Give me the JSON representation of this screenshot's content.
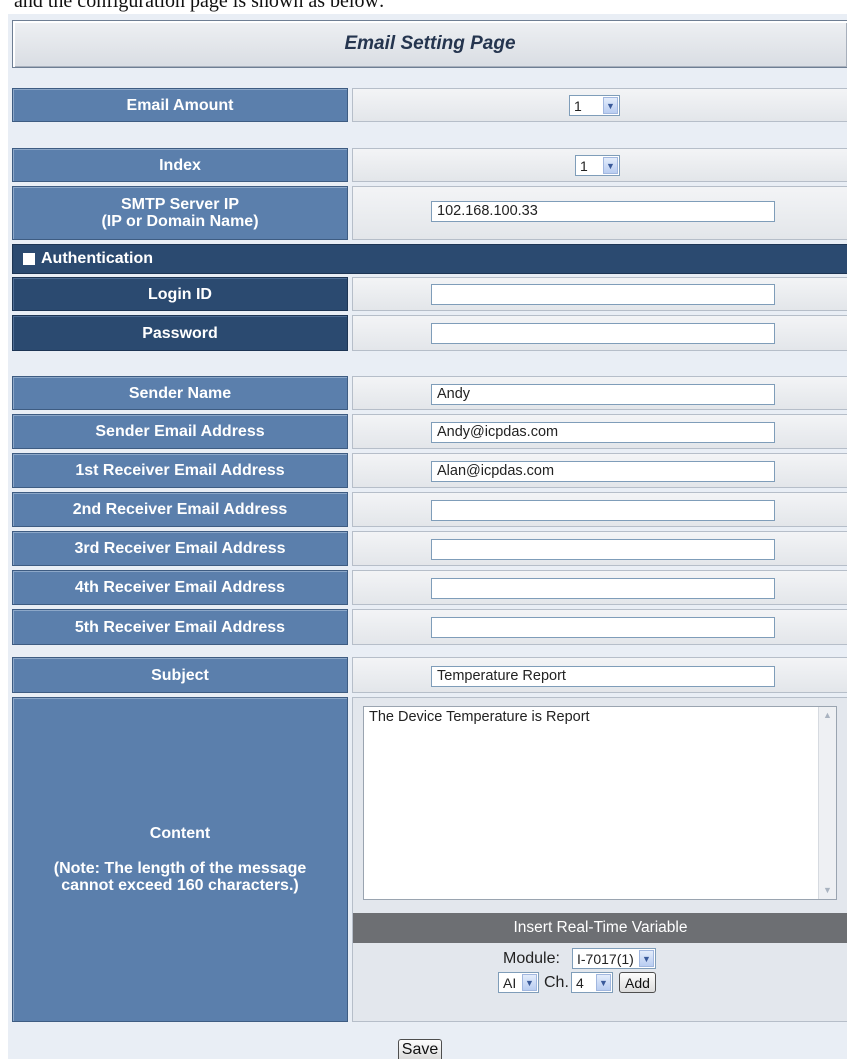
{
  "top_caption": "and the configuration page is shown as below:",
  "page_title": "Email Setting Page",
  "email_amount": {
    "label": "Email Amount",
    "value": "1"
  },
  "index": {
    "label": "Index",
    "value": "1"
  },
  "smtp": {
    "label_line1": "SMTP Server IP",
    "label_line2": "(IP or Domain Name)",
    "value": "102.168.100.33"
  },
  "auth": {
    "label": "Authentication",
    "login_label": "Login ID",
    "login_value": "",
    "password_label": "Password",
    "password_value": ""
  },
  "sender": {
    "name_label": "Sender Name",
    "name_value": "Andy",
    "email_label": "Sender Email Address",
    "email_value": "Andy@icpdas.com"
  },
  "receivers": [
    {
      "label": "1st Receiver Email Address",
      "value": "Alan@icpdas.com"
    },
    {
      "label": "2nd Receiver Email Address",
      "value": ""
    },
    {
      "label": "3rd Receiver Email Address",
      "value": ""
    },
    {
      "label": "4th Receiver Email Address",
      "value": ""
    },
    {
      "label": "5th Receiver Email Address",
      "value": ""
    }
  ],
  "subject": {
    "label": "Subject",
    "value": "Temperature Report"
  },
  "content": {
    "label": "Content",
    "note": "(Note: The length of the message cannot exceed 160 characters.)",
    "value": "The Device Temperature is Report"
  },
  "insert_variable": {
    "title": "Insert Real-Time Variable",
    "module_label": "Module:",
    "module_value": "I-7017(1)",
    "type_value": "AI",
    "ch_label": "Ch.",
    "ch_value": "4",
    "add_label": "Add"
  },
  "save_label": "Save"
}
